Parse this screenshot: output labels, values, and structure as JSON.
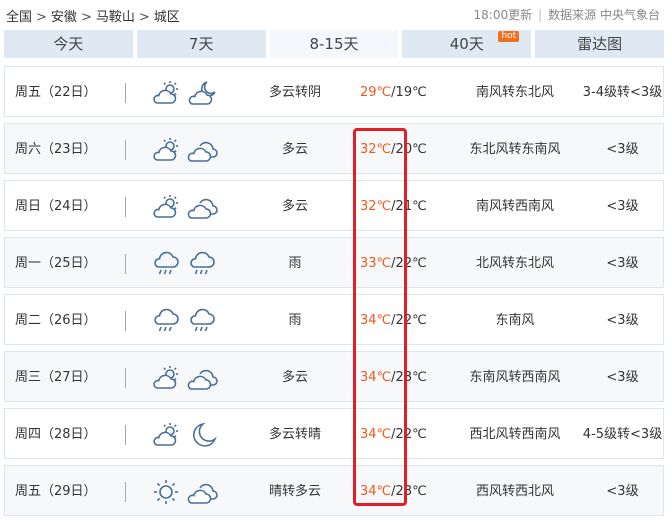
{
  "breadcrumb": [
    "全国",
    "安徽",
    "马鞍山",
    "城区"
  ],
  "breadcrumb_sep": ">",
  "update_time": "18:00更新",
  "source": "数据来源 中央气象台",
  "tabs": [
    {
      "label": "今天",
      "active": false
    },
    {
      "label": "7天",
      "active": false
    },
    {
      "label": "8-15天",
      "active": true
    },
    {
      "label": "40天",
      "active": false,
      "badge": "hot"
    },
    {
      "label": "雷达图",
      "active": false
    }
  ],
  "days": [
    {
      "day": "周五（22日）",
      "icon1": "partly-cloudy-day-icon",
      "icon2": "partly-cloudy-night-icon",
      "weather": "多云转阴",
      "hi": "29℃",
      "lo": "19℃",
      "wind": "南风转东北风",
      "level": "3-4级转<3级"
    },
    {
      "day": "周六（23日）",
      "icon1": "partly-cloudy-day-icon",
      "icon2": "cloudy-icon",
      "weather": "多云",
      "hi": "32℃",
      "lo": "20℃",
      "wind": "东北风转东南风",
      "level": "<3级"
    },
    {
      "day": "周日（24日）",
      "icon1": "partly-cloudy-day-icon",
      "icon2": "cloudy-icon",
      "weather": "多云",
      "hi": "32℃",
      "lo": "21℃",
      "wind": "南风转西南风",
      "level": "<3级"
    },
    {
      "day": "周一（25日）",
      "icon1": "rain-icon",
      "icon2": "rain-icon",
      "weather": "雨",
      "hi": "33℃",
      "lo": "22℃",
      "wind": "北风转东北风",
      "level": "<3级"
    },
    {
      "day": "周二（26日）",
      "icon1": "rain-icon",
      "icon2": "rain-icon",
      "weather": "雨",
      "hi": "34℃",
      "lo": "22℃",
      "wind": "东南风",
      "level": "<3级"
    },
    {
      "day": "周三（27日）",
      "icon1": "partly-cloudy-day-icon",
      "icon2": "cloudy-icon",
      "weather": "多云",
      "hi": "34℃",
      "lo": "23℃",
      "wind": "东南风转西南风",
      "level": "<3级"
    },
    {
      "day": "周四（28日）",
      "icon1": "partly-cloudy-day-icon",
      "icon2": "moon-icon",
      "weather": "多云转晴",
      "hi": "34℃",
      "lo": "22℃",
      "wind": "西北风转西南风",
      "level": "4-5级转<3级"
    },
    {
      "day": "周五（29日）",
      "icon1": "sun-icon",
      "icon2": "cloudy-icon",
      "weather": "晴转多云",
      "hi": "34℃",
      "lo": "23℃",
      "wind": "西风转西北风",
      "level": "<3级"
    }
  ],
  "colors": {
    "high_temp": "#f05a1e",
    "highlight_box": "#e21f26",
    "tab_bg": "#dfe9f4",
    "hot_badge": "#f07020"
  }
}
